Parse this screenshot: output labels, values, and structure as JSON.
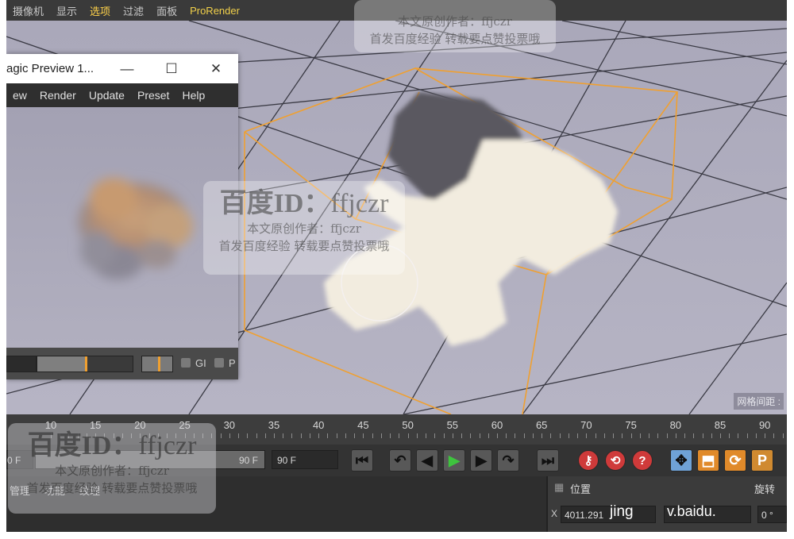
{
  "menubar": {
    "items": [
      {
        "label": "摄像机",
        "active": false
      },
      {
        "label": "显示",
        "active": false
      },
      {
        "label": "选项",
        "active": true
      },
      {
        "label": "过滤",
        "active": false
      },
      {
        "label": "面板",
        "active": false
      },
      {
        "label": "ProRender",
        "active": false
      }
    ]
  },
  "viewport": {
    "grid_spacing_label": "网格间距 :"
  },
  "preview_window": {
    "title": "agic Preview 1...",
    "minimize": "—",
    "maximize": "☐",
    "close": "✕",
    "menu": [
      "ew",
      "Render",
      "Update",
      "Preset",
      "Help"
    ],
    "gi_label": "GI",
    "p_label": "P"
  },
  "timeline": {
    "ticks": [
      10,
      15,
      20,
      25,
      30,
      35,
      40,
      45,
      50,
      55,
      60,
      65,
      70,
      75,
      80,
      85,
      90
    ]
  },
  "transport": {
    "start_frame": "0 F",
    "end_frame_slider": "90 F",
    "end_frame": "90 F"
  },
  "panels": {
    "object_tabs": [
      "管理",
      "功能",
      "纹理"
    ],
    "position_label": "位置",
    "rotation_label": "旋转",
    "x_label": "X",
    "x_value": "4011.291",
    "rot_value": "0 °",
    "overlay_text_1": "jing",
    "overlay_text_2": "v.baidu."
  },
  "watermarks": {
    "id_text": "百度ID：",
    "id_name": "ffjczr",
    "line1": "本文原创作者：ffjczr",
    "line2": "首发百度经验 转载要点赞投票哦"
  },
  "colors": {
    "accent_yellow": "#ffd24a",
    "selection_orange": "#f0a030",
    "record_red": "#cf3a3a",
    "play_green": "#3ec43e"
  }
}
